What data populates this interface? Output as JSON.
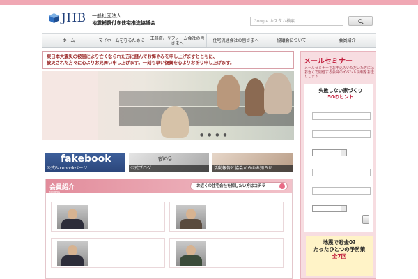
{
  "header": {
    "logo_text": "JHB",
    "org_type": "一般社団法人",
    "org_name": "地震補償付き住宅推進協議会"
  },
  "search": {
    "placeholder": "カスタム検索",
    "brand": "Google"
  },
  "nav": [
    {
      "label": "ホーム"
    },
    {
      "label": "マイホームを守るために"
    },
    {
      "label": "工務店、リフォーム会社の皆さまへ"
    },
    {
      "label": "住宅流通会社の皆さまへ"
    },
    {
      "label": "協議会について"
    },
    {
      "label": "会員紹介"
    }
  ],
  "notice": {
    "line1": "東日本大震災の被害により亡くなられた方に謹んでお悔やみを申し上げますとともに、",
    "line2": "被災された方々に心よりお見舞い申し上げます。一刻も早い復興を心よりお祈り申し上げます。"
  },
  "banners": [
    {
      "title": "fakebook",
      "label": "公式Facebookページ"
    },
    {
      "title": "Blog",
      "label": "公式ブログ"
    },
    {
      "title": "",
      "label": "活動報告と協会からのお知らせ"
    }
  ],
  "members": {
    "title": "会員紹介",
    "subtitle": "MEMBERS",
    "search_button": "お近くの住宅会社を探したい方はコチラ"
  },
  "sidebar": {
    "title": "メールセミナー",
    "intro": "メールセミナーをお申込みいただいた方にはお近くで開催する会員のイベント情報をお送りします",
    "promo1_line1": "失敗しない家づくり",
    "promo1_line2": "50のヒント",
    "promo2_line1": "地震で貯金0?",
    "promo2_line2": "たったひとつの予防策",
    "promo2_line3": "全7回"
  },
  "colors": {
    "accent": "#c2213f",
    "brand_blue": "#1f3f7a",
    "pink_bar": "#f0a8b4"
  }
}
